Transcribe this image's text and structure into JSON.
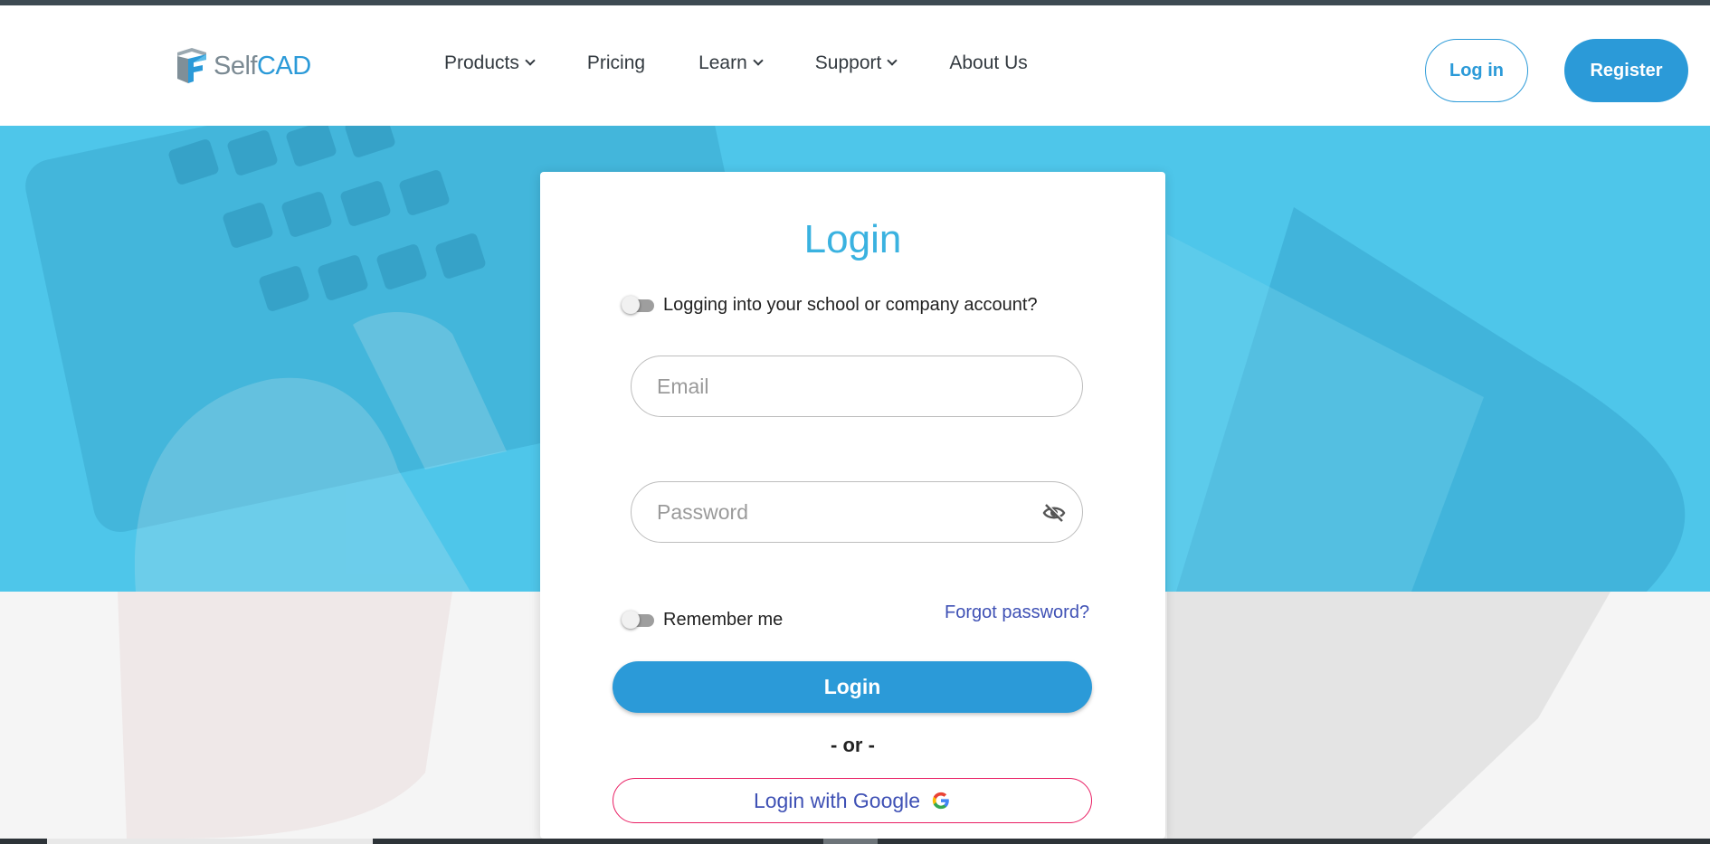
{
  "brand": {
    "name_part1": "Self",
    "name_part2": "CAD",
    "accent_color": "#2b9ad8"
  },
  "nav": {
    "items": [
      {
        "label": "Products",
        "has_dropdown": true
      },
      {
        "label": "Pricing",
        "has_dropdown": false
      },
      {
        "label": "Learn",
        "has_dropdown": true
      },
      {
        "label": "Support",
        "has_dropdown": true
      },
      {
        "label": "About Us",
        "has_dropdown": false
      }
    ],
    "login_label": "Log in",
    "register_label": "Register"
  },
  "login_form": {
    "title": "Login",
    "school_toggle_label": "Logging into your school or company account?",
    "school_toggle_on": false,
    "email_placeholder": "Email",
    "email_value": "",
    "password_placeholder": "Password",
    "password_value": "",
    "remember_label": "Remember me",
    "remember_on": false,
    "forgot_label": "Forgot password?",
    "submit_label": "Login",
    "or_label": "- or -",
    "google_label": "Login with Google"
  },
  "colors": {
    "hero": "#4ec6ea",
    "title": "#3ab2e0",
    "link": "#3f51b5",
    "google_border": "#e91e63"
  }
}
